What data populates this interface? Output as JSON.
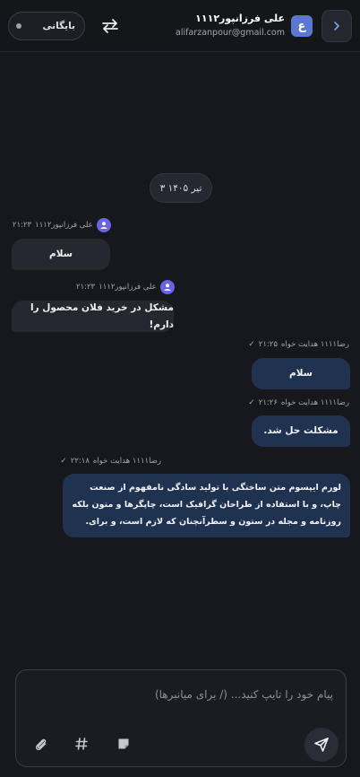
{
  "header": {
    "user_name": "علی فرزانپور۱۱۱۲",
    "user_email": "alifarzanpour@gmail.com",
    "avatar_letter": "ع",
    "status_label": "بایگانی"
  },
  "chat": {
    "date_chip": "۳ تیر ۱۴۰۵",
    "messages": [
      {
        "direction": "in",
        "sender": "علی فرزانپور۱۱۱۲",
        "time": "۲۱:۲۳",
        "text": "سلام"
      },
      {
        "direction": "in",
        "sender": "علی فرزانپور۱۱۱۲",
        "time": "۲۱:۲۳",
        "text": "مشکل در خرید فلان محصول را دارم!"
      },
      {
        "direction": "out",
        "sender": "رضا۱۱۱۱ هدایت خواه",
        "time": "۲۱:۲۵",
        "text": "سلام"
      },
      {
        "direction": "out",
        "sender": "رضا۱۱۱۱ هدایت خواه",
        "time": "۲۱:۲۶",
        "text": "مشکلت حل شد."
      },
      {
        "direction": "out",
        "sender": "رضا۱۱۱۱ هدایت خواه",
        "time": "۲۲:۱۸",
        "text": "لورم ایپسوم متن ساختگی با تولید سادگی نامفهوم از صنعت چاپ، و با استفاده از طراحان گرافیک است، چاپگرها و متون بلکه روزنامه و مجله در ستون و سطرآنچنان که لازم است، و برای."
      }
    ]
  },
  "composer": {
    "placeholder": "پیام خود را تایپ کنید... (/ برای میانبرها)"
  },
  "colors": {
    "background": "#17181d",
    "incoming_bubble": "#262830",
    "outgoing_bubble": "#1f3250",
    "avatar_accent": "#5a78cf",
    "user_dot": "#6a64e0"
  },
  "icons": [
    "chevron-right-icon",
    "swap-arrows-icon",
    "user-icon",
    "check-icon",
    "paperclip-icon",
    "hashtag-icon",
    "note-icon",
    "send-icon"
  ]
}
